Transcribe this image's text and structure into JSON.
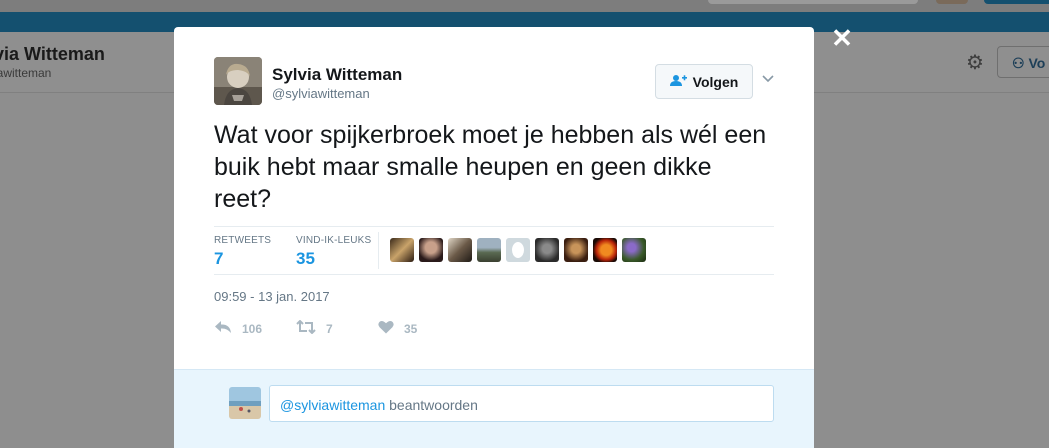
{
  "background": {
    "profile_name": "via Witteman",
    "profile_handle": "iawitteman",
    "follow_label": "Vo"
  },
  "tweet": {
    "author_name": "Sylvia Witteman",
    "author_handle": "@sylviawitteman",
    "follow_label": "Volgen",
    "text": "Wat voor spijkerbroek moet je hebben als wél een buik hebt maar smalle heupen en geen dikke reet?",
    "retweets_label": "RETWEETS",
    "retweets_count": "7",
    "likes_label": "VIND-IK-LEUKS",
    "likes_count": "35",
    "timestamp": "09:59 - 13 jan. 2017",
    "actions": {
      "reply_count": "106",
      "retweet_count": "7",
      "like_count": "35"
    }
  },
  "reply": {
    "mention": "@sylviawitteman",
    "placeholder_rest": " beantwoorden"
  },
  "colors": {
    "accent": "#1b95e0",
    "overlay": "#8e8e8e",
    "reply_bg": "#e8f5fd"
  },
  "icons": {
    "close": "close-icon",
    "gear": "gear-icon",
    "follow": "add-user-icon",
    "dropdown": "chevron-down-icon",
    "reply": "reply-icon",
    "retweet": "retweet-icon",
    "like": "heart-icon"
  }
}
